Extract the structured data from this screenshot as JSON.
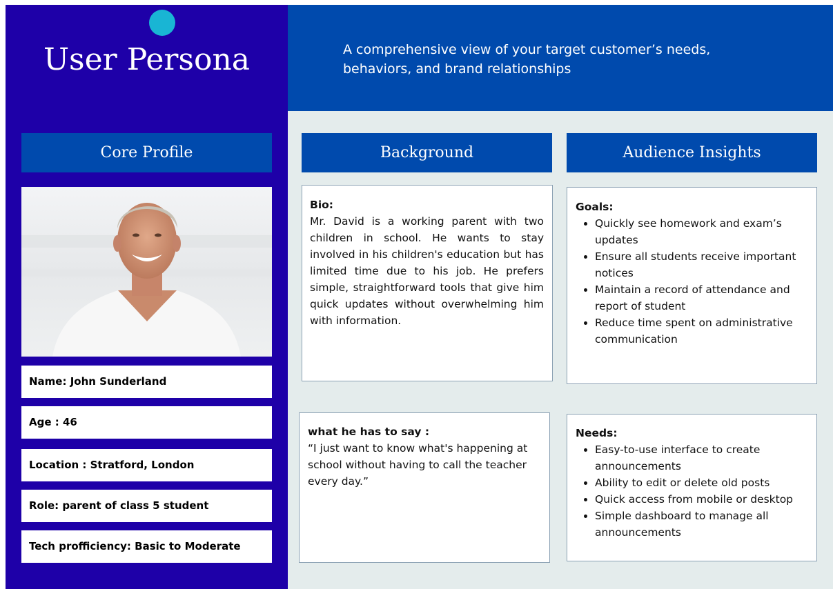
{
  "header": {
    "title": "User Persona",
    "subtitle": "A comprehensive view of your target customer’s needs, behaviors, and brand relationships"
  },
  "sections": {
    "core_profile": "Core Profile",
    "background": "Background",
    "audience_insights": "Audience Insights"
  },
  "profile": {
    "name": "Name: John  Sunderland",
    "age": "Age : 46",
    "location": "Location : Stratford, London",
    "role": "Role: parent of class 5 student",
    "tech": "Tech profficiency: Basic to Moderate"
  },
  "bio": {
    "label": "Bio:",
    "text": "Mr. David is a working parent with two children in school. He wants to stay involved in his children's education but has limited time due to his job. He prefers simple, straightforward tools that give him quick updates without overwhelming him with information."
  },
  "quote": {
    "label": "what he has to say :",
    "text": "“I just want to know what's happening at school without having to call the teacher every day.”"
  },
  "goals": {
    "label": "Goals:",
    "items": [
      "Quickly see homework and exam’s updates",
      "Ensure all students receive important notices",
      "Maintain a record of  attendance and report of student",
      "Reduce time spent on administrative communication"
    ]
  },
  "needs": {
    "label": "Needs:",
    "items": [
      "Easy-to-use interface to create announcements",
      "Ability to edit or delete old posts",
      "Quick access from mobile or desktop",
      "Simple dashboard to manage all announcements"
    ]
  },
  "colors": {
    "left_panel": "#1e00a8",
    "accent_blue": "#004aad",
    "dot": "#19b5d4",
    "content_bg": "#e4ecec"
  }
}
